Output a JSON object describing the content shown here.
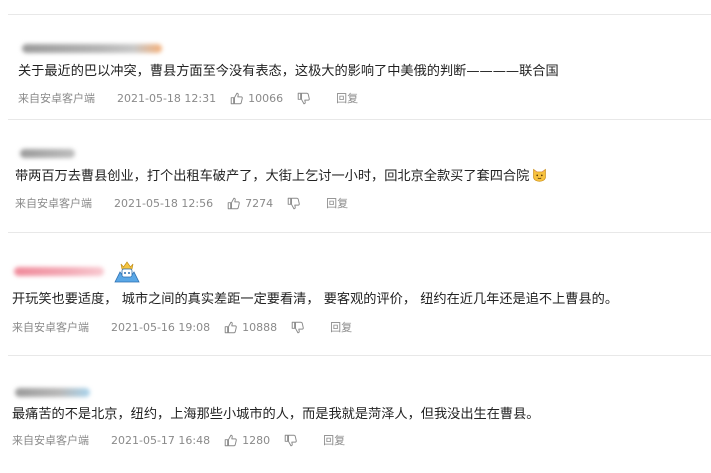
{
  "colors": {
    "text": "#222222",
    "meta": "#8a8a8a",
    "divider": "#e8e8e8"
  },
  "comments": [
    {
      "username_blurred": "blurred-username",
      "text": "关于最近的巴以冲突，曹县方面至今没有表态，这极大的影响了中美俄的判断————联合国",
      "source": "来自安卓客户端",
      "time": "2021-05-18 12:31",
      "likes": "10066",
      "reply": "回复"
    },
    {
      "username_blurred": "blurred-username",
      "text": "带两百万去曹县创业，打个出租车破产了，大街上乞讨一小时，回北京全款买了套四合院",
      "emoji": "cat-face-emoji",
      "source": "来自安卓客户端",
      "time": "2021-05-18 12:56",
      "likes": "7274",
      "reply": "回复"
    },
    {
      "username_blurred": "blurred-username",
      "badge": "crown-badge-icon",
      "text": "开玩笑也要适度， 城市之间的真实差距一定要看清， 要客观的评价， 纽约在近几年还是追不上曹县的。",
      "source": "来自安卓客户端",
      "time": "2021-05-16 19:08",
      "likes": "10888",
      "reply": "回复"
    },
    {
      "username_blurred": "blurred-username",
      "text": "最痛苦的不是北京，纽约，上海那些小城市的人，而是我就是菏泽人，但我没出生在曹县。",
      "source": "来自安卓客户端",
      "time": "2021-05-17 16:48",
      "likes": "1280",
      "reply": "回复"
    }
  ]
}
